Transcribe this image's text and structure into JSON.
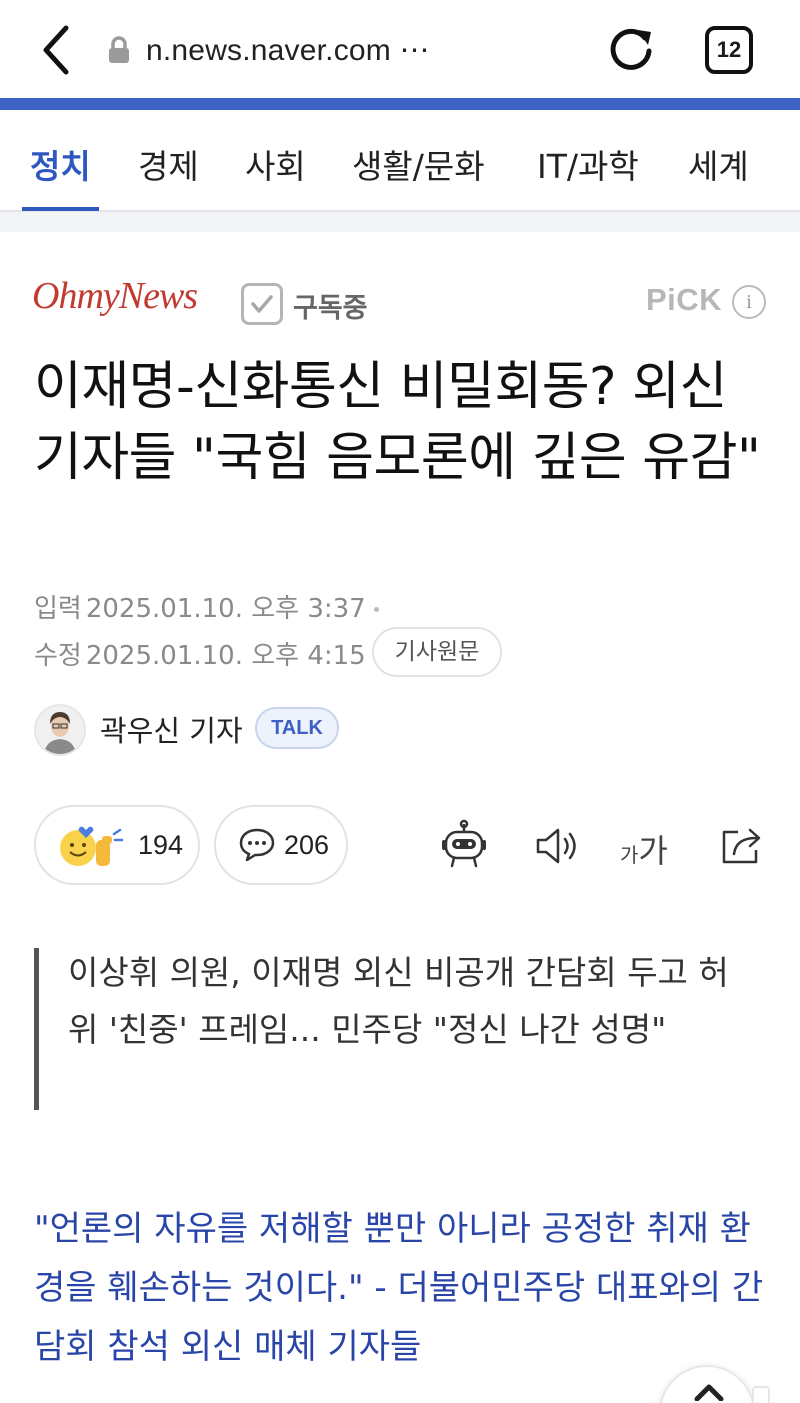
{
  "browser": {
    "url": "n.news.naver.com ⋯",
    "tab_count": "12"
  },
  "categories": [
    {
      "label": "정치",
      "active": true
    },
    {
      "label": "경제",
      "active": false
    },
    {
      "label": "사회",
      "active": false
    },
    {
      "label": "생활/문화",
      "active": false
    },
    {
      "label": "IT/과학",
      "active": false
    },
    {
      "label": "세계",
      "active": false
    }
  ],
  "press": {
    "logo_text": "OhmyNews",
    "subscribe_label": "구독중",
    "pick_label": "PiCK",
    "info_symbol": "i"
  },
  "article": {
    "headline": "이재명-신화통신 비밀회동? 외신기자들 \"국힘 음모론에 깊은 유감\"",
    "input_label": "입력",
    "input_date": "2025.01.10. 오후 3:37",
    "modified_label": "수정",
    "modified_date": "2025.01.10. 오후 4:15",
    "original_button": "기사원문",
    "reporter": "곽우신 기자",
    "talk_label": "TALK",
    "like_count": "194",
    "comment_count": "206",
    "summary": "이상휘 의원, 이재명 외신 비공개 간담회 두고 허위 '친중' 프레임... 민주당 \"정신 나간 성명\"",
    "quote": "\"언론의 자유를 저해할 뿐만 아니라 공정한 취재 환경을 훼손하는 것이다.\" - 더불어민주당 대표와의 간담회 참석 외신 매체 기자들"
  },
  "tools": {
    "font_small": "가",
    "font_large": "가"
  },
  "colors": {
    "accent_blue": "#2e58c0",
    "brand_strip": "#3d63c6",
    "press_red": "#c23a30",
    "quote_blue": "#2a45a8"
  }
}
